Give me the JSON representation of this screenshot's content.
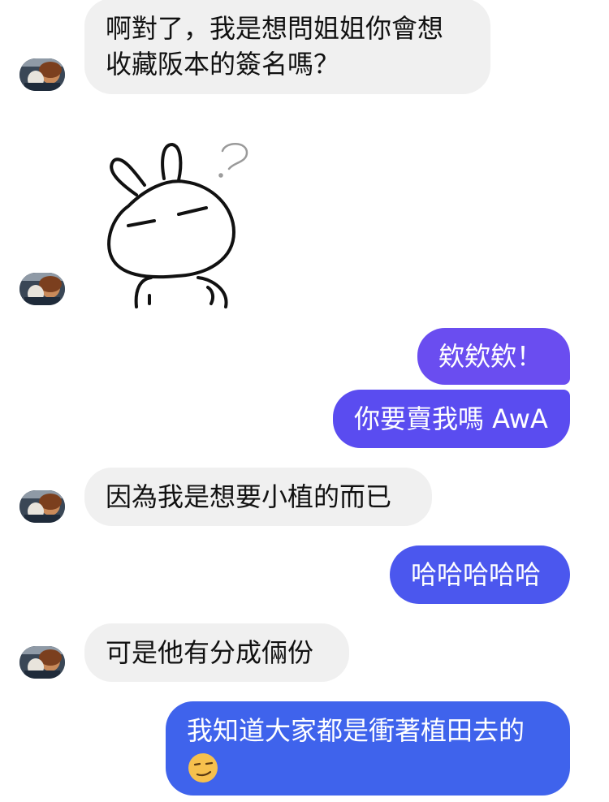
{
  "messages": {
    "m1": {
      "line1": "啊對了，我是想問姐姐你會想",
      "line2": "收藏阪本的簽名嗎？"
    },
    "m3": "欸欸欸！",
    "m4": "你要賣我嗎 AwA",
    "m5": "因為我是想要小植的而已",
    "m6": "哈哈哈哈哈",
    "m7": "可是他有分成倆份",
    "m8": {
      "line1": "我知道大家都是衝著植田去的"
    }
  },
  "sticker": {
    "name": "rabbit-sticker"
  },
  "colors": {
    "incoming_bg": "#f0f0f0",
    "outgoing_top": "#6a4df0",
    "outgoing_mid": "#5a4cf0",
    "outgoing_bottom": "#3f63ec"
  }
}
